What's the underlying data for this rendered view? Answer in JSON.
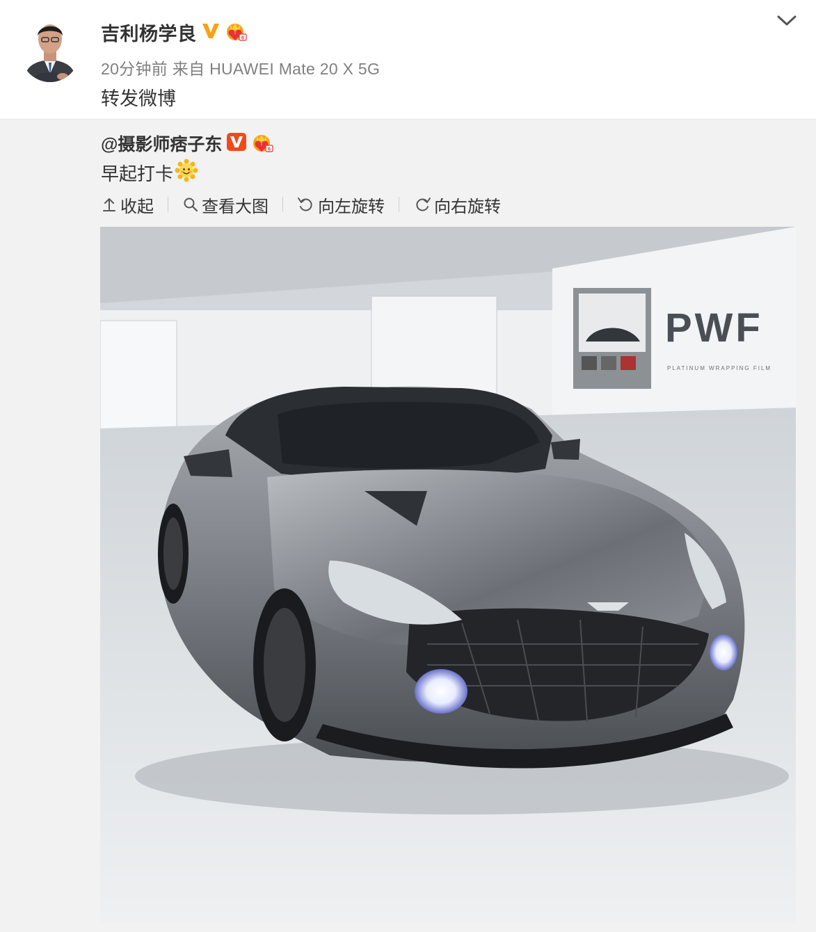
{
  "post": {
    "author": "吉利杨学良",
    "meta": "20分钟前 来自 HUAWEI Mate 20 X 5G",
    "text": "转发微博"
  },
  "retweet": {
    "author": "@摄影师痞子东",
    "text": "早起打卡"
  },
  "toolbar": {
    "collapse": "收起",
    "view_large": "查看大图",
    "rotate_left": "向左旋转",
    "rotate_right": "向右旋转"
  },
  "photo": {
    "poster_logo": "PWF",
    "poster_subtitle": "PLATINUM WRAPPING FILM"
  },
  "colors": {
    "verified_gold": "#f6a316",
    "verified_orange": "#f04a1a",
    "repost_bg": "#f2f2f2",
    "meta_gray": "#808080",
    "text": "#333333"
  },
  "icons": [
    "chevron-down-icon",
    "verified-v-icon",
    "vip-crown-icon",
    "sun-emoji-icon",
    "collapse-icon",
    "search-icon",
    "rotate-left-icon",
    "rotate-right-icon"
  ]
}
